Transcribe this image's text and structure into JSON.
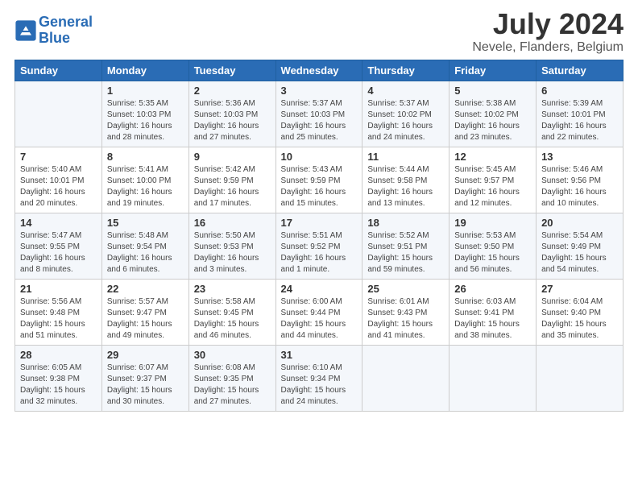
{
  "header": {
    "logo_line1": "General",
    "logo_line2": "Blue",
    "title": "July 2024",
    "subtitle": "Nevele, Flanders, Belgium"
  },
  "weekdays": [
    "Sunday",
    "Monday",
    "Tuesday",
    "Wednesday",
    "Thursday",
    "Friday",
    "Saturday"
  ],
  "weeks": [
    [
      {
        "day": "",
        "info": ""
      },
      {
        "day": "1",
        "info": "Sunrise: 5:35 AM\nSunset: 10:03 PM\nDaylight: 16 hours\nand 28 minutes."
      },
      {
        "day": "2",
        "info": "Sunrise: 5:36 AM\nSunset: 10:03 PM\nDaylight: 16 hours\nand 27 minutes."
      },
      {
        "day": "3",
        "info": "Sunrise: 5:37 AM\nSunset: 10:03 PM\nDaylight: 16 hours\nand 25 minutes."
      },
      {
        "day": "4",
        "info": "Sunrise: 5:37 AM\nSunset: 10:02 PM\nDaylight: 16 hours\nand 24 minutes."
      },
      {
        "day": "5",
        "info": "Sunrise: 5:38 AM\nSunset: 10:02 PM\nDaylight: 16 hours\nand 23 minutes."
      },
      {
        "day": "6",
        "info": "Sunrise: 5:39 AM\nSunset: 10:01 PM\nDaylight: 16 hours\nand 22 minutes."
      }
    ],
    [
      {
        "day": "7",
        "info": "Sunrise: 5:40 AM\nSunset: 10:01 PM\nDaylight: 16 hours\nand 20 minutes."
      },
      {
        "day": "8",
        "info": "Sunrise: 5:41 AM\nSunset: 10:00 PM\nDaylight: 16 hours\nand 19 minutes."
      },
      {
        "day": "9",
        "info": "Sunrise: 5:42 AM\nSunset: 9:59 PM\nDaylight: 16 hours\nand 17 minutes."
      },
      {
        "day": "10",
        "info": "Sunrise: 5:43 AM\nSunset: 9:59 PM\nDaylight: 16 hours\nand 15 minutes."
      },
      {
        "day": "11",
        "info": "Sunrise: 5:44 AM\nSunset: 9:58 PM\nDaylight: 16 hours\nand 13 minutes."
      },
      {
        "day": "12",
        "info": "Sunrise: 5:45 AM\nSunset: 9:57 PM\nDaylight: 16 hours\nand 12 minutes."
      },
      {
        "day": "13",
        "info": "Sunrise: 5:46 AM\nSunset: 9:56 PM\nDaylight: 16 hours\nand 10 minutes."
      }
    ],
    [
      {
        "day": "14",
        "info": "Sunrise: 5:47 AM\nSunset: 9:55 PM\nDaylight: 16 hours\nand 8 minutes."
      },
      {
        "day": "15",
        "info": "Sunrise: 5:48 AM\nSunset: 9:54 PM\nDaylight: 16 hours\nand 6 minutes."
      },
      {
        "day": "16",
        "info": "Sunrise: 5:50 AM\nSunset: 9:53 PM\nDaylight: 16 hours\nand 3 minutes."
      },
      {
        "day": "17",
        "info": "Sunrise: 5:51 AM\nSunset: 9:52 PM\nDaylight: 16 hours\nand 1 minute."
      },
      {
        "day": "18",
        "info": "Sunrise: 5:52 AM\nSunset: 9:51 PM\nDaylight: 15 hours\nand 59 minutes."
      },
      {
        "day": "19",
        "info": "Sunrise: 5:53 AM\nSunset: 9:50 PM\nDaylight: 15 hours\nand 56 minutes."
      },
      {
        "day": "20",
        "info": "Sunrise: 5:54 AM\nSunset: 9:49 PM\nDaylight: 15 hours\nand 54 minutes."
      }
    ],
    [
      {
        "day": "21",
        "info": "Sunrise: 5:56 AM\nSunset: 9:48 PM\nDaylight: 15 hours\nand 51 minutes."
      },
      {
        "day": "22",
        "info": "Sunrise: 5:57 AM\nSunset: 9:47 PM\nDaylight: 15 hours\nand 49 minutes."
      },
      {
        "day": "23",
        "info": "Sunrise: 5:58 AM\nSunset: 9:45 PM\nDaylight: 15 hours\nand 46 minutes."
      },
      {
        "day": "24",
        "info": "Sunrise: 6:00 AM\nSunset: 9:44 PM\nDaylight: 15 hours\nand 44 minutes."
      },
      {
        "day": "25",
        "info": "Sunrise: 6:01 AM\nSunset: 9:43 PM\nDaylight: 15 hours\nand 41 minutes."
      },
      {
        "day": "26",
        "info": "Sunrise: 6:03 AM\nSunset: 9:41 PM\nDaylight: 15 hours\nand 38 minutes."
      },
      {
        "day": "27",
        "info": "Sunrise: 6:04 AM\nSunset: 9:40 PM\nDaylight: 15 hours\nand 35 minutes."
      }
    ],
    [
      {
        "day": "28",
        "info": "Sunrise: 6:05 AM\nSunset: 9:38 PM\nDaylight: 15 hours\nand 32 minutes."
      },
      {
        "day": "29",
        "info": "Sunrise: 6:07 AM\nSunset: 9:37 PM\nDaylight: 15 hours\nand 30 minutes."
      },
      {
        "day": "30",
        "info": "Sunrise: 6:08 AM\nSunset: 9:35 PM\nDaylight: 15 hours\nand 27 minutes."
      },
      {
        "day": "31",
        "info": "Sunrise: 6:10 AM\nSunset: 9:34 PM\nDaylight: 15 hours\nand 24 minutes."
      },
      {
        "day": "",
        "info": ""
      },
      {
        "day": "",
        "info": ""
      },
      {
        "day": "",
        "info": ""
      }
    ]
  ]
}
